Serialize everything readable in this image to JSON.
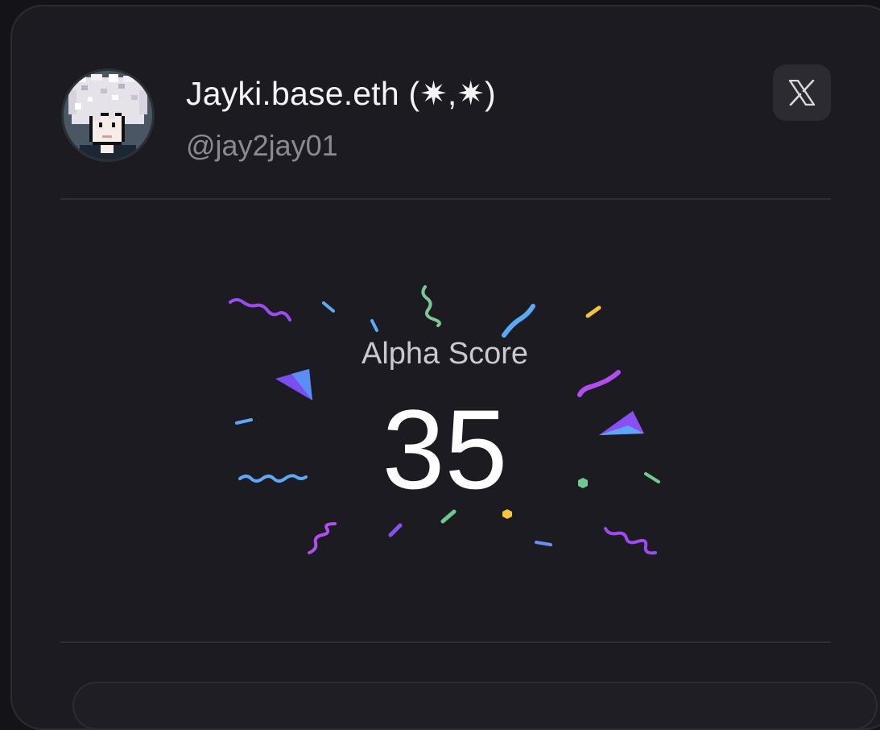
{
  "profile": {
    "display_name": "Jayki.base.eth (✷,✷)",
    "handle": "@jay2jay01",
    "avatar_icon": "pixel-art-avatar-icon"
  },
  "actions": {
    "x_icon": "x-logo-icon"
  },
  "score": {
    "label": "Alpha Score",
    "value": "35"
  },
  "colors": {
    "card_background": "#1b1b21",
    "text_primary": "#f4f4f6",
    "text_secondary": "#8a8a92",
    "confetti_purple": "#a855f7",
    "confetti_blue": "#60a5fa",
    "confetti_green": "#86c99a",
    "confetti_yellow": "#facc15"
  }
}
